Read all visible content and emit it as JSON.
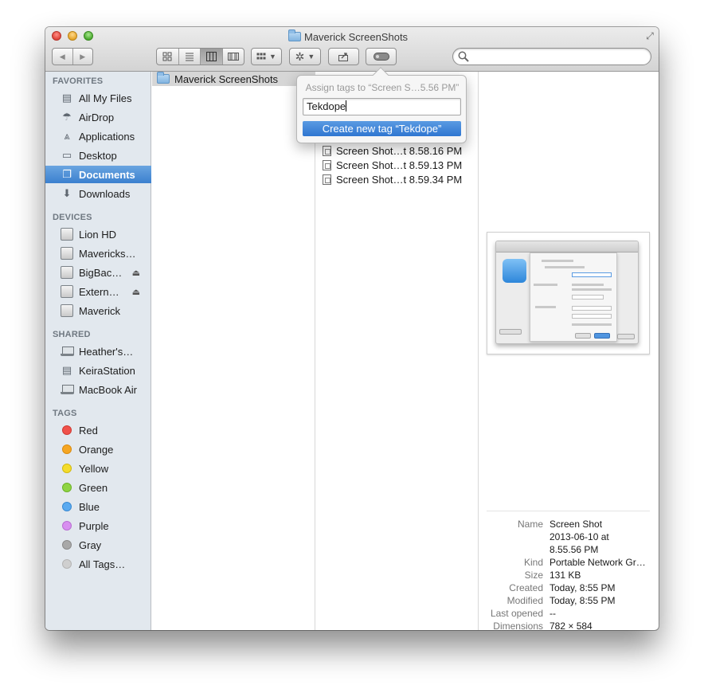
{
  "window": {
    "title": "Maverick ScreenShots"
  },
  "toolbar": {
    "back_glyph": "◀",
    "forward_glyph": "▶",
    "view_icons": [
      "icon-view-icon",
      "list-view-icon",
      "column-view-icon",
      "coverflow-view-icon"
    ],
    "active_view": "column-view-icon",
    "search_placeholder": ""
  },
  "sidebar": {
    "favorites_header": "FAVORITES",
    "favorites": [
      {
        "label": "All My Files",
        "icon": "all-my-files-icon"
      },
      {
        "label": "AirDrop",
        "icon": "airdrop-icon"
      },
      {
        "label": "Applications",
        "icon": "applications-icon"
      },
      {
        "label": "Desktop",
        "icon": "desktop-icon"
      },
      {
        "label": "Documents",
        "icon": "documents-icon",
        "selected": true
      },
      {
        "label": "Downloads",
        "icon": "downloads-icon"
      }
    ],
    "devices_header": "DEVICES",
    "devices": [
      {
        "label": "Lion HD",
        "icon": "disk-icon"
      },
      {
        "label": "Mavericks…",
        "icon": "disk-icon"
      },
      {
        "label": "BigBac…",
        "icon": "disk-icon",
        "eject": true
      },
      {
        "label": "Extern…",
        "icon": "disk-icon",
        "eject": true
      },
      {
        "label": "Maverick",
        "icon": "disk-icon"
      }
    ],
    "shared_header": "SHARED",
    "shared": [
      {
        "label": "Heather's…",
        "icon": "laptop-icon"
      },
      {
        "label": "KeiraStation",
        "icon": "server-icon"
      },
      {
        "label": "MacBook Air",
        "icon": "laptop-icon"
      }
    ],
    "tags_header": "TAGS",
    "tags": [
      {
        "label": "Red",
        "color": "#f0514a"
      },
      {
        "label": "Orange",
        "color": "#f5a623"
      },
      {
        "label": "Yellow",
        "color": "#f4dc2c"
      },
      {
        "label": "Green",
        "color": "#8fd442"
      },
      {
        "label": "Blue",
        "color": "#5aaaf0"
      },
      {
        "label": "Purple",
        "color": "#d88ff0"
      },
      {
        "label": "Gray",
        "color": "#a8a8a8"
      },
      {
        "label": "All Tags…",
        "color": "#cfcfcf"
      }
    ]
  },
  "columns": {
    "col1": [
      {
        "label": "Maverick ScreenShots"
      }
    ],
    "col2": [
      {
        "label": "Screen Shot…t 8.58.16 PM"
      },
      {
        "label": "Screen Shot…t 8.59.13 PM"
      },
      {
        "label": "Screen Shot…t 8.59.34 PM"
      }
    ]
  },
  "tag_popover": {
    "title": "Assign tags to “Screen S…5.56 PM”",
    "input_value": "Tekdope",
    "suggestion": "Create new tag “Tekdope”"
  },
  "preview": {
    "info": [
      {
        "key": "Name",
        "value": [
          "Screen Shot",
          "2013-06-10 at",
          "8.55.56 PM"
        ]
      },
      {
        "key": "Kind",
        "value": [
          "Portable Network Gr…"
        ]
      },
      {
        "key": "Size",
        "value": [
          "131 KB"
        ]
      },
      {
        "key": "Created",
        "value": [
          "Today, 8:55 PM"
        ]
      },
      {
        "key": "Modified",
        "value": [
          "Today, 8:55 PM"
        ]
      },
      {
        "key": "Last opened",
        "value": [
          "--"
        ]
      },
      {
        "key": "Dimensions",
        "value": [
          "782 × 584"
        ]
      }
    ]
  }
}
